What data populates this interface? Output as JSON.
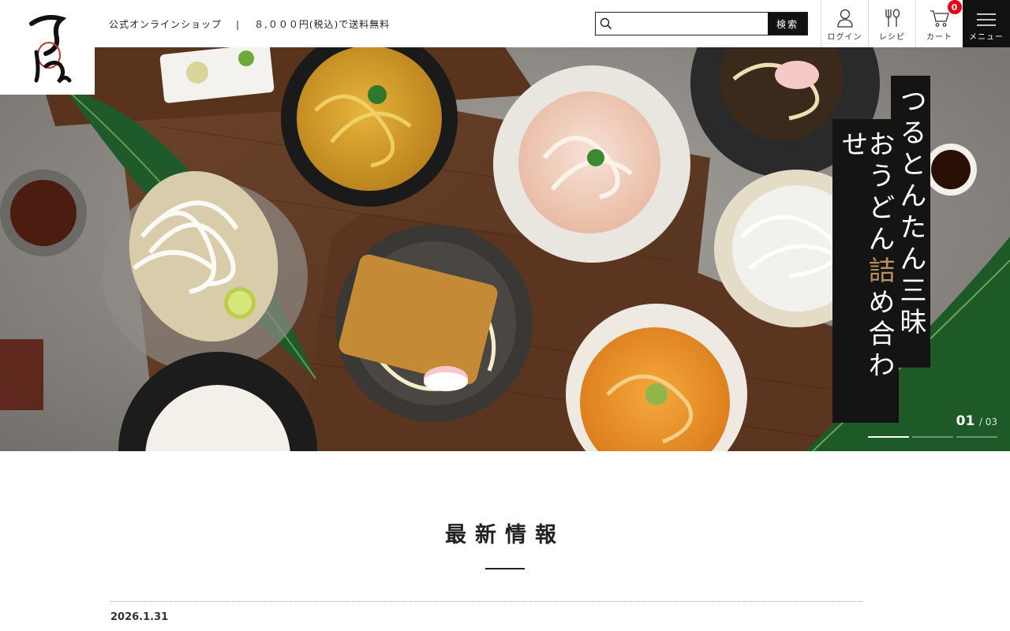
{
  "brand": {
    "logo_text": "つるとんたん",
    "logo_icon": "brush-calligraphy-logo"
  },
  "header": {
    "shop_label": "公式オンラインショップ",
    "separator": "|",
    "shipping_note": "８,０００円(税込)で送料無料",
    "search": {
      "placeholder": "",
      "value": "",
      "button_label": "検索",
      "icon": "search-icon"
    },
    "icons": [
      {
        "name": "login",
        "label": "ログイン",
        "icon": "person-icon"
      },
      {
        "name": "recipe",
        "label": "レシピ",
        "icon": "fork-spoon-icon"
      },
      {
        "name": "cart",
        "label": "カート",
        "icon": "cart-icon",
        "count": "0"
      },
      {
        "name": "menu",
        "label": "メニュー",
        "icon": "hamburger-icon"
      }
    ],
    "badge_color": "#e60012"
  },
  "hero": {
    "headline_1": "つるとんたん三昧",
    "headline_2_a": "おうどん",
    "headline_2_accent": "詰",
    "headline_2_b": "め合わせ",
    "accent_color": "#b9915a",
    "slide_current": "01",
    "slide_total": "/ 03",
    "slide_index": 1,
    "slide_count": 3
  },
  "news": {
    "title": "最新情報",
    "items": [
      {
        "date": "2026.1.31"
      }
    ]
  }
}
